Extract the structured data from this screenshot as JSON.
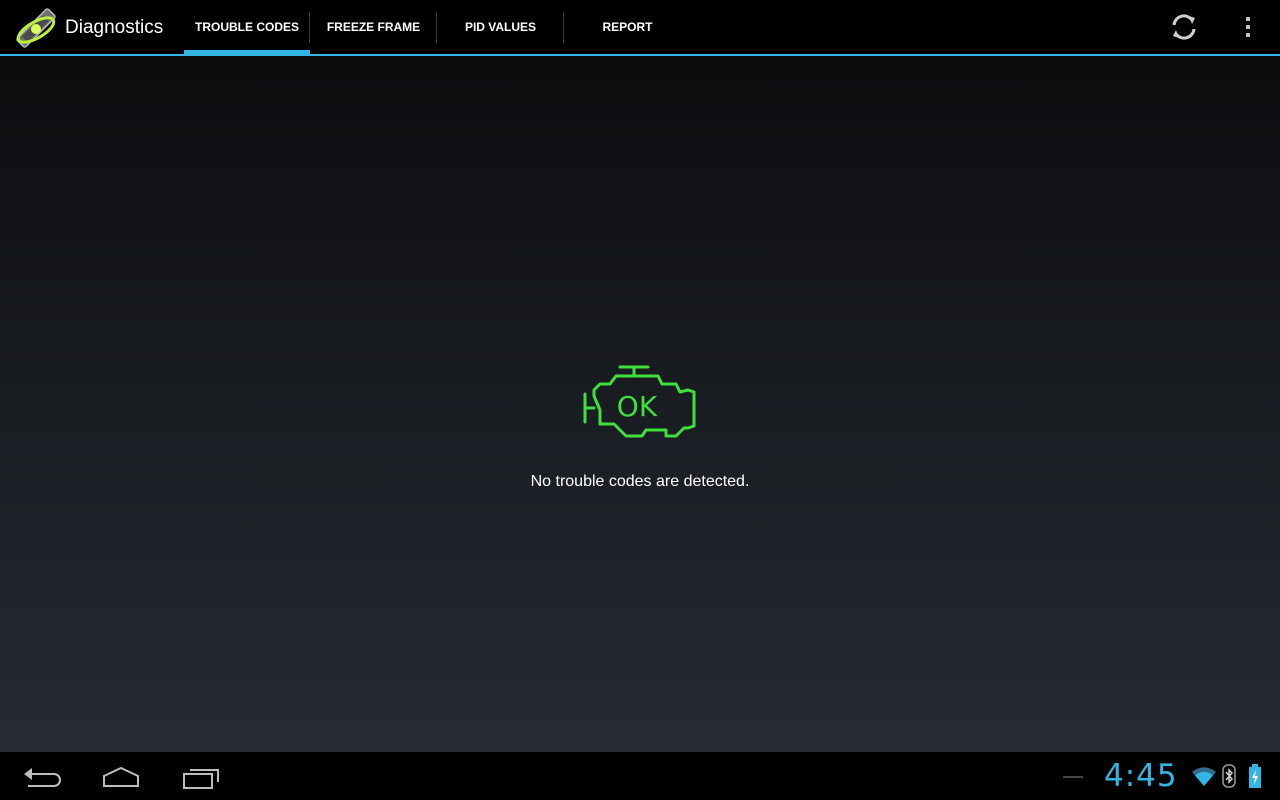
{
  "action_bar": {
    "title": "Diagnostics",
    "logo_icon": "obd-wand-logo-icon",
    "tabs": [
      {
        "label": "TROUBLE CODES",
        "selected": true
      },
      {
        "label": "FREEZE FRAME",
        "selected": false
      },
      {
        "label": "PID VALUES",
        "selected": false
      },
      {
        "label": "REPORT",
        "selected": false
      }
    ],
    "refresh_icon": "refresh-icon",
    "overflow_icon": "overflow-menu-icon"
  },
  "content": {
    "engine_badge_text": "OK",
    "engine_icon": "check-engine-icon",
    "message": "No trouble codes are detected."
  },
  "system_bar": {
    "clock": "4:45",
    "icons": [
      "back-icon",
      "home-icon",
      "recents-icon",
      "wifi-icon",
      "bluetooth-icon",
      "battery-charging-icon"
    ]
  },
  "colors": {
    "accent": "#33b5e5",
    "engine_ok": "#3ee03e",
    "text": "#ffffff",
    "bar_background": "#000000"
  }
}
